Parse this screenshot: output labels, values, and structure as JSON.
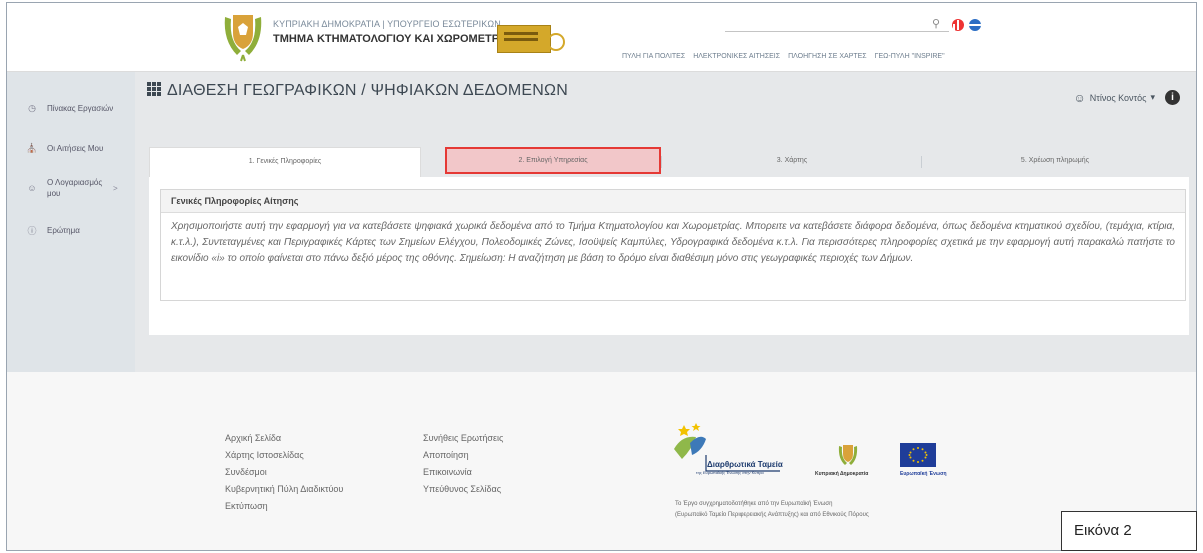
{
  "header": {
    "org_line1": "ΚΥΠΡΙΑΚΗ ΔΗΜΟΚΡΑΤΙΑ | ΥΠΟΥΡΓΕΙΟ ΕΣΩΤΕΡΙΚΩΝ",
    "org_line2": "ΤΜΗΜΑ ΚΤΗΜΑΤΟΛΟΓΙΟΥ ΚΑΙ ΧΩΡΟΜΕΤΡΙΑΣ",
    "search_icon": "search-icon",
    "nav": [
      "ΠΥΛΗ ΓΙΑ ΠΟΛΙΤΕΣ",
      "ΗΛΕΚΤΡΟΝΙΚΕΣ ΑΙΤΗΣΕΙΣ",
      "ΠΛΟΗΓΗΣΗ ΣΕ ΧΑΡΤΕΣ",
      "ΓΕΩ-ΠΥΛΗ \"INSPIRE\""
    ]
  },
  "sidebar": {
    "items": [
      {
        "icon": "clock-icon",
        "label": "Πίνακας Εργασιών"
      },
      {
        "icon": "bank-icon",
        "label": "Οι Αιτήσεις Μου"
      },
      {
        "icon": "user-icon",
        "label": "Ο Λογαριασμός μου",
        "chevron": ">"
      },
      {
        "icon": "question-icon",
        "label": "Ερώτημα"
      }
    ]
  },
  "main": {
    "title": "ΔΙΑΘΕΣΗ ΓΕΩΓΡΑΦΙΚΩΝ / ΨΗΦΙΑΚΩΝ ΔΕΔΟΜΕΝΩΝ",
    "user_name": "Ντίνος Κοντός",
    "user_caret": "▾",
    "info_glyph": "i",
    "tabs": [
      {
        "label": "1. Γενικές Πληροφορίες",
        "state": "active"
      },
      {
        "label": "2. Επιλογή Υπηρεσίας",
        "state": "highlighted"
      },
      {
        "label": "3. Χάρτης",
        "state": "inactive"
      },
      {
        "label": "5. Χρέωση πληρωμής",
        "state": "inactive"
      }
    ],
    "panel_title": "Γενικές Πληροφορίες Αίτησης",
    "panel_text": "Χρησιμοποιήστε αυτή την εφαρμογή για να κατεβάσετε ψηφιακά χωρικά δεδομένα από το Τμήμα Κτηματολογίου και Χωρομετρίας. Μπορειτε να κατεβάσετε διάφορα δεδομένα, όπως δεδομένα κτηματικού σχεδίου, (τεμάχια, κτίρια, κ.τ.λ.), Συντεταγμένες και Περιγραφικές Κάρτες των Σημείων Ελέγχου, Πολεοδομικές Ζώνες, Ισοϋψείς Καμπύλες, Υδρογραφικά δεδομένα κ.τ.λ. Για περισσότερες πληροφορίες σχετικά με την εφαρμογή αυτή παρακαλώ πατήστε το εικονίδιο «i» το οποίο φαίνεται στο πάνω δεξιό μέρος της οθόνης. Σημείωση: Η αναζήτηση με βάση το δρόμο είναι διαθέσιμη μόνο στις γεωγραφικές περιοχές των Δήμων."
  },
  "footer": {
    "col1": [
      "Αρχική Σελίδα",
      "Χάρτης Ιστοσελίδας",
      "Συνδέσμοι",
      "Κυβερνητική Πύλη Διαδικτύου",
      "Εκτύπωση"
    ],
    "col2": [
      "Συνήθεις Ερωτήσεις",
      "Αποποίηση",
      "Επικοινωνία",
      "Υπεύθυνος Σελίδας"
    ],
    "eu_funds_title": "Διαρθρωτικά Ταμεία",
    "eu_funds_sub": "της Ευρωπαϊκής Ένωσης στην Κύπρο",
    "cy_label": "Κυπριακή Δημοκρατία",
    "eu_label": "Ευρωπαϊκή Ένωση",
    "note_line1": "Το Έργο συγχρηματοδοτήθηκε από την Ευρωπαϊκή Ένωση",
    "note_line2": "(Ευρωπαϊκό Ταμείο Περιφερειακής Ανάπτυξης) και από Εθνικούς Πόρους"
  },
  "figure_label": "Εικόνα 2",
  "colors": {
    "highlight_border": "#e53935",
    "highlight_fill": "#f2c7c9",
    "sidebar_bg": "#dfe4e8",
    "main_bg": "#e6e8ea",
    "badge_gold": "#d4a82a",
    "eu_blue": "#1f3d99"
  }
}
